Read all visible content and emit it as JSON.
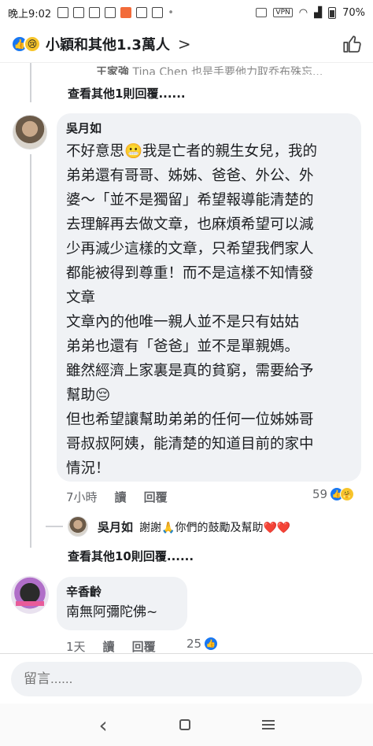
{
  "status_bar": {
    "time": "晚上9:02",
    "vpn": "VPN",
    "battery": "70%"
  },
  "header": {
    "title": "小穎和其他1.3萬人",
    "chevron": ">"
  },
  "thread_top": {
    "cut_author": "王家強",
    "cut_text": "Tina Chen 也是手要他力取乔布殊忘...",
    "view_more": "查看其他1則回覆......"
  },
  "comment1": {
    "author": "吳月如",
    "body": "不好意思😬我是亡者的親生女兒，我的\n弟弟還有哥哥、姊姊、爸爸、外公、外\n婆～「並不是獨留」希望報導能清楚的\n去理解再去做文章，也麻煩希望可以減\n少再減少這樣的文章，只希望我們家人\n都能被得到尊重！而不是這樣不知情發\n文章\n文章內的他唯一親人並不是只有姑姑\n弟弟也還有「爸爸」並不是單親媽。\n雖然經濟上家裏是真的貧窮，需要給予\n幫助😔\n但也希望讓幫助弟弟的任何一位姊姊哥\n哥叔叔阿姨，能清楚的知道目前的家中\n情況！",
    "time": "7小時",
    "read": "讀",
    "reply": "回覆",
    "reaction_count": "59"
  },
  "reply1": {
    "author": "吳月如",
    "text": "謝謝🙏你們的鼓勵及幫助❤️❤️",
    "view_more": "查看其他10則回覆......"
  },
  "comment2": {
    "author": "辛香齡",
    "body": "南無阿彌陀佛~",
    "time": "1天",
    "read": "讀",
    "reply": "回覆",
    "reaction_count": "25"
  },
  "composer": {
    "placeholder": "留言......"
  },
  "nav": {
    "back": "‹"
  }
}
